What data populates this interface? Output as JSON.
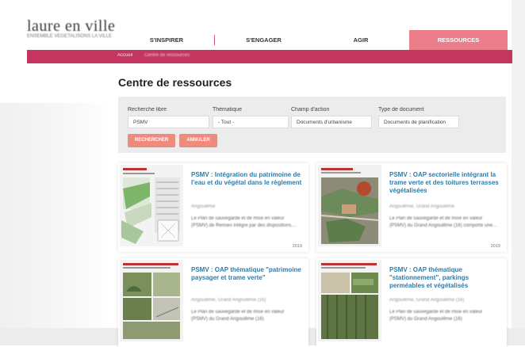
{
  "header": {
    "brand": "laure en ville",
    "tagline": "ENSEMBLE VÉGÉTALISONS LA VILLE"
  },
  "nav": {
    "items": [
      "S'INSPIRER",
      "S'ENGAGER",
      "AGIR",
      "RESSOURCES"
    ],
    "active": "RESSOURCES",
    "accent": "#ec7e8c",
    "bar_color": "#c43660"
  },
  "breadcrumb": {
    "home": "Accueil",
    "current": "Centre de ressources"
  },
  "page": {
    "title": "Centre de ressources"
  },
  "filters": {
    "keyword": {
      "label": "Recherche libre",
      "value": "PSMV"
    },
    "theme": {
      "label": "Thématique",
      "value": "- Tout -"
    },
    "field": {
      "label": "Champ d'action",
      "value": "Documents d'urbanisme"
    },
    "doctype": {
      "label": "Type de document",
      "value": "Documents de planification"
    },
    "search_button": "RECHERCHER",
    "reset_button": "ANNULER"
  },
  "results": [
    {
      "title": "PSMV : Intégration du patrimoine de l'eau et du végétal dans le règlement",
      "meta": "Angoulême",
      "desc": "Le Plan de sauvegarde et de mise en valeur (PSMV) de Rennes intègre par des dispositions…",
      "year": "2019"
    },
    {
      "title": "PSMV : OAP sectorielle intégrant la trame verte et des toitures terrasses végétalisées",
      "meta": "Angoulême, Grand Angoulême",
      "desc": "Le Plan de sauvegarde et de mise en valeur (PSMV) du Grand Angoulême (16) comporte une…",
      "year": "2019"
    },
    {
      "title": "PSMV : OAP thématique \"patrimoine paysager et trame verte\"",
      "meta": "Angoulême, Grand Angoulême (16)",
      "desc": "Le Plan de sauvegarde et de mise en valeur (PSMV) du Grand Angoulême (16)",
      "year": ""
    },
    {
      "title": "PSMV : OAP thématique \"stationnement\", parkings perméables et végétalisés",
      "meta": "Angoulême, Grand Angoulême (16)",
      "desc": "Le Plan de sauvegarde et de mise en valeur (PSMV) du Grand Angoulême (16)",
      "year": ""
    }
  ]
}
